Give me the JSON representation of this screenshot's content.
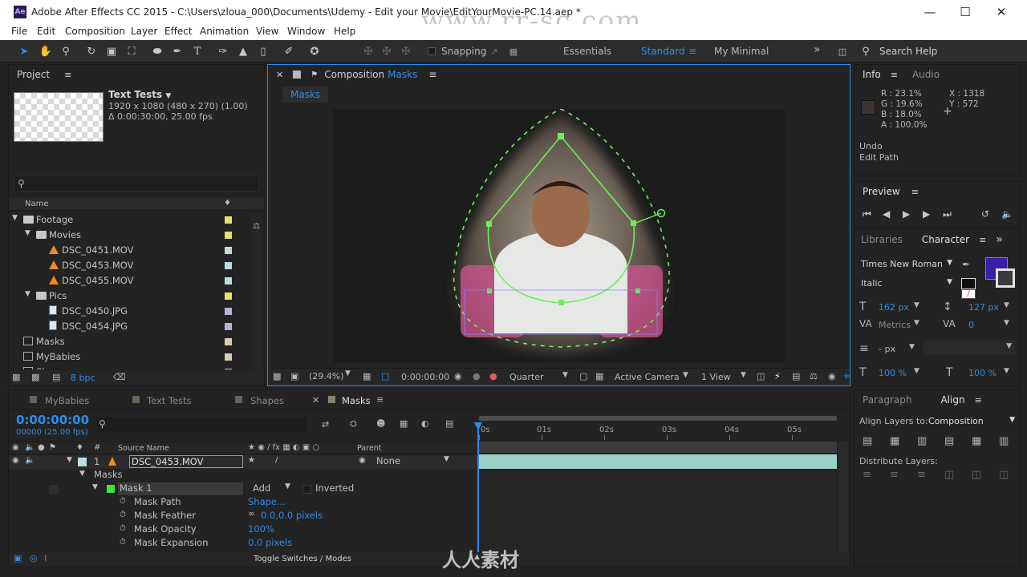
{
  "window": {
    "logo": "Ae",
    "title": "Adobe After Effects CC 2015 - C:\\Users\\zloua_000\\Documents\\Udemy - Edit your Movie\\EditYourMovie-PC.14.aep *",
    "watermark": "www.rr-sc.com"
  },
  "menu": [
    "File",
    "Edit",
    "Composition",
    "Layer",
    "Effect",
    "Animation",
    "View",
    "Window",
    "Help"
  ],
  "toolbar": {
    "snapping": "Snapping",
    "workspaces": [
      "Essentials",
      "Standard",
      "My Minimal"
    ],
    "active_workspace": "Standard",
    "search": "Search Help"
  },
  "project": {
    "title": "Project",
    "item_name": "Text Tests",
    "item_size": "1920 x 1080  (480 x 270) (1.00)",
    "item_duration": "Δ 0:00:30:00, 25.00 fps",
    "col_name": "Name",
    "tree": [
      {
        "label": "Footage",
        "kind": "folder",
        "swatch": "#e6e46b"
      },
      {
        "label": "Movies",
        "kind": "folder",
        "swatch": "#e6e46b"
      },
      {
        "label": "DSC_0451.MOV",
        "kind": "vlc",
        "swatch": "#b9e0e0"
      },
      {
        "label": "DSC_0453.MOV",
        "kind": "vlc",
        "swatch": "#b9e0e0"
      },
      {
        "label": "DSC_0455.MOV",
        "kind": "vlc",
        "swatch": "#b9e0e0"
      },
      {
        "label": "Pics",
        "kind": "folder",
        "swatch": "#e6e46b"
      },
      {
        "label": "DSC_0450.JPG",
        "kind": "img",
        "swatch": "#b3b3dc"
      },
      {
        "label": "DSC_0454.JPG",
        "kind": "img",
        "swatch": "#b3b3dc"
      },
      {
        "label": "Masks",
        "kind": "comp",
        "swatch": "#d8cfb1"
      },
      {
        "label": "MyBabies",
        "kind": "comp",
        "swatch": "#d8cfb1"
      },
      {
        "label": "Shapes",
        "kind": "comp",
        "swatch": "#d8cfb1"
      }
    ],
    "bpc": "8 bpc"
  },
  "composition": {
    "title_prefix": "Composition",
    "name": "Masks",
    "tab": "Masks",
    "zoom": "(29.4%)",
    "timecode": "0:00:00:00",
    "resolution": "Quarter",
    "camera": "Active Camera",
    "views": "1 View",
    "plus": "+"
  },
  "info": {
    "title": "Info",
    "audio": "Audio",
    "r": "R : 23.1%",
    "g": "G : 19.6%",
    "b": "B : 18.0%",
    "a": "A : 100.0%",
    "x": "X : 1318",
    "y": "Y : 572",
    "undo": "Undo",
    "last_action": "Edit Path"
  },
  "preview": {
    "title": "Preview"
  },
  "character": {
    "tabs": [
      "Libraries",
      "Character"
    ],
    "font": "Times New Roman",
    "style": "Italic",
    "size": "162 px",
    "leading": "127 px",
    "kerning": "Metrics",
    "tracking": "0",
    "stroke": "- px",
    "vscale": "100 %",
    "hscale": "100 %",
    "fill_color": "#3a1ea6"
  },
  "align": {
    "tabs": [
      "Paragraph",
      "Align"
    ],
    "align_to_label": "Align Layers to:",
    "align_to": "Composition",
    "distribute": "Distribute Layers:"
  },
  "timeline": {
    "tabs": [
      "MyBabies",
      "Text Tests",
      "Shapes",
      "Masks"
    ],
    "active_tab": "Masks",
    "timecode": "0:00:00:00",
    "frames": "00000 (25.00 fps)",
    "col_source": "Source Name",
    "col_parent": "Parent",
    "layer_num": "1",
    "layer_name": "DSC_0453.MOV",
    "parent": "None",
    "masks_group": "Masks",
    "mask_name": "Mask 1",
    "mask_mode": "Add",
    "inverted": "Inverted",
    "props": [
      {
        "name": "Mask Path",
        "value": "Shape..."
      },
      {
        "name": "Mask Feather",
        "value": "0.0,0.0 pixels"
      },
      {
        "name": "Mask Opacity",
        "value": "100%"
      },
      {
        "name": "Mask Expansion",
        "value": "0.0 pixels"
      }
    ],
    "ruler": [
      "0s",
      "01s",
      "02s",
      "03s",
      "04s",
      "05s"
    ],
    "toggle": "Toggle Switches / Modes",
    "bottom_watermark": "人人素材"
  }
}
